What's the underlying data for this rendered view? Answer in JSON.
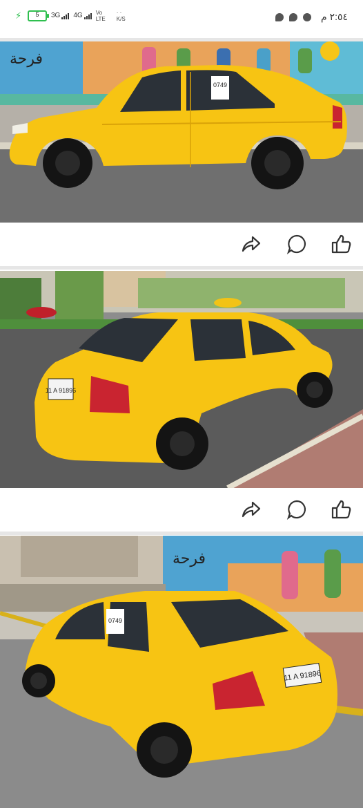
{
  "status_bar": {
    "battery_level": "5",
    "network_1": "3G",
    "network_2": "4G",
    "volte": "Vo",
    "volte_sub": "LTE",
    "speed": "K/S",
    "time": "٢:٥٤ م",
    "icons": [
      "messenger-icon",
      "chat-icon",
      "settings-icon"
    ]
  },
  "photos": [
    {
      "plate_tag": "0749",
      "description_icon": "photo"
    },
    {
      "plate": "11 A 91896",
      "description_icon": "photo"
    },
    {
      "plate": "11 A 91896",
      "sign": "0749",
      "description_icon": "photo"
    }
  ],
  "actions": {
    "share_icon": "share-icon",
    "comment_icon": "comment-icon",
    "like_icon": "like-icon"
  },
  "colors": {
    "car": "#f7c413",
    "accent_green": "#2fbf4f",
    "separator": "#e6e6e6",
    "icon": "#333333"
  }
}
